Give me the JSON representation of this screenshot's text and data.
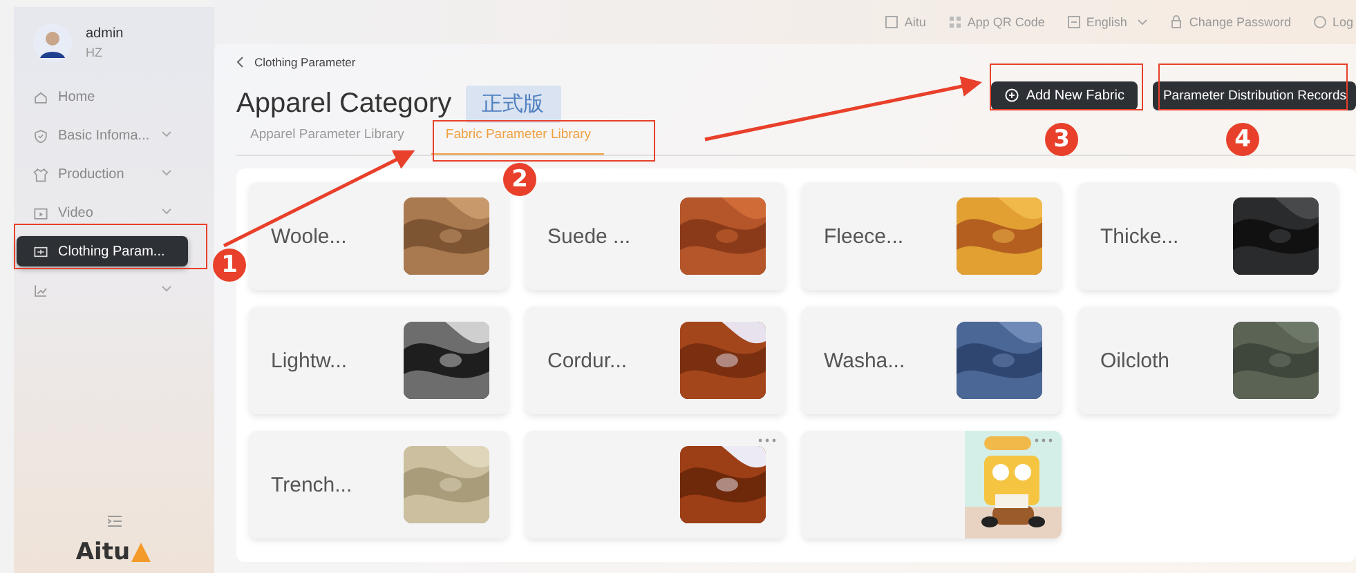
{
  "user": {
    "name": "admin",
    "org": "HZ"
  },
  "sidebar": {
    "items": [
      {
        "label": "Home",
        "caret": false,
        "selected": false
      },
      {
        "label": "Basic Infoma...",
        "caret": true,
        "selected": false
      },
      {
        "label": "Production",
        "caret": true,
        "selected": false
      },
      {
        "label": "Video",
        "caret": true,
        "selected": false
      },
      {
        "label": "Clothing Param...",
        "caret": false,
        "selected": true
      },
      {
        "caret": true,
        "selected": false
      }
    ],
    "logo": "Aitu"
  },
  "header_links": [
    {
      "label": "Aitu",
      "caret": false
    },
    {
      "label": "App QR Code",
      "caret": false
    },
    {
      "label": "English",
      "caret": true
    },
    {
      "label": "Change Password",
      "caret": false
    },
    {
      "label": "Log",
      "caret": false
    }
  ],
  "breadcrumb": "Clothing Parameter",
  "title": "Apparel Category",
  "badge": "正式版",
  "tabs": [
    {
      "label": "Apparel Parameter Library",
      "selected": false
    },
    {
      "label": "Fabric Parameter Library",
      "selected": true
    }
  ],
  "buttons": [
    {
      "label": "Add New Fabric",
      "kind": "add"
    },
    {
      "label": "Parameter Distribution Records",
      "kind": "plain"
    }
  ],
  "fabrics": [
    {
      "name": "Woole...",
      "more_menu": false
    },
    {
      "name": "Suede ...",
      "more_menu": false
    },
    {
      "name": "Fleece...",
      "more_menu": false
    },
    {
      "name": "Thicke...",
      "more_menu": false
    },
    {
      "name": "Lightw...",
      "more_menu": false
    },
    {
      "name": "Cordur...",
      "more_menu": false
    },
    {
      "name": "Washa...",
      "more_menu": false
    },
    {
      "name": "Oilcloth",
      "more_menu": false
    },
    {
      "name": "Trench...",
      "more_menu": false
    },
    {
      "more_menu": true
    },
    {
      "more_menu": true
    }
  ],
  "annotations": [
    {
      "label": "1"
    },
    {
      "label": "2"
    },
    {
      "label": "3"
    },
    {
      "label": "4"
    }
  ]
}
